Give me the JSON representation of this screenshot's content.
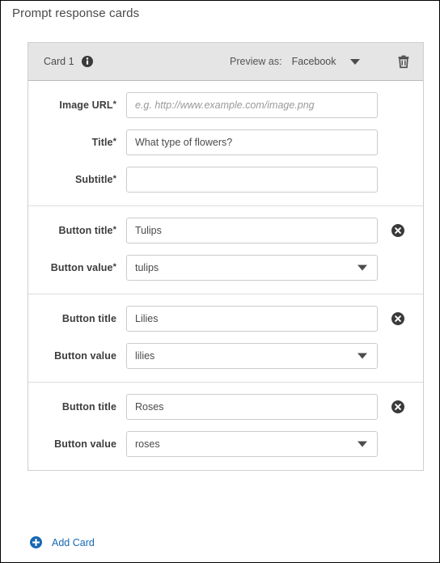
{
  "page": {
    "title": "Prompt response cards"
  },
  "card": {
    "header": {
      "card_label": "Card 1",
      "info_icon": "info-icon",
      "preview_as_label": "Preview as:",
      "preview_as_value": "Facebook",
      "preview_caret_icon": "chevron-down-icon",
      "delete_icon": "trash-icon"
    },
    "content_section": {
      "fields": [
        {
          "label": "Image URL",
          "required": true,
          "type": "text",
          "value": "",
          "placeholder": "e.g. http://www.example.com/image.png"
        },
        {
          "label": "Title",
          "required": true,
          "type": "text",
          "value": "What type of flowers?",
          "placeholder": ""
        },
        {
          "label": "Subtitle",
          "required": true,
          "type": "text",
          "value": "",
          "placeholder": ""
        }
      ]
    },
    "button_sections": [
      {
        "title_label": "Button title",
        "title_required": true,
        "title_value": "Tulips",
        "value_label": "Button value",
        "value_required": true,
        "value_selected": "tulips",
        "remove_icon": "remove-circle-icon",
        "value_caret_icon": "chevron-down-icon"
      },
      {
        "title_label": "Button title",
        "title_required": false,
        "title_value": "Lilies",
        "value_label": "Button value",
        "value_required": false,
        "value_selected": "lilies",
        "remove_icon": "remove-circle-icon",
        "value_caret_icon": "chevron-down-icon"
      },
      {
        "title_label": "Button title",
        "title_required": false,
        "title_value": "Roses",
        "value_label": "Button value",
        "value_required": false,
        "value_selected": "roses",
        "remove_icon": "remove-circle-icon",
        "value_caret_icon": "chevron-down-icon"
      }
    ]
  },
  "footer": {
    "add_card_label": "Add Card",
    "add_card_icon": "plus-circle-icon"
  },
  "colors": {
    "link": "#1767b5",
    "header_bg": "#e5e5e5",
    "border": "#cfcfcf",
    "label_text": "#3d3d3d",
    "placeholder_text": "#9a9a9a"
  },
  "asterisk": "*"
}
